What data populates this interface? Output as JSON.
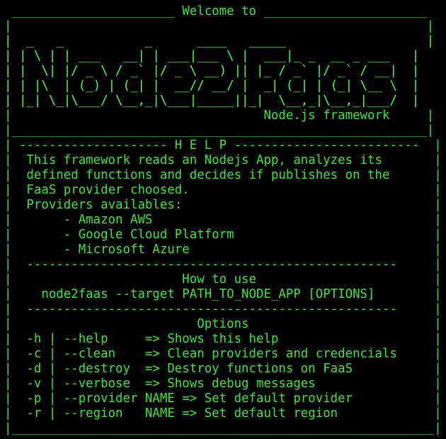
{
  "colors": {
    "background": "#000000",
    "text": "#39e639"
  },
  "terminal": {
    "lines": [
      " ______________________ Welcome to ______________________",
      "|                                                        |",
      "|  _   _           _      ____   _____                   |",
      "| | \\ | | ___   __| | ___|___ \\ |  ___|_ _  __ _ ___   |",
      "| |  \\| |/ _ \\ / _` |/ _ \\ __) || |_ / _` |/ _` / __|  |",
      "| | |\\  | (_) | (_| |  __// __/ |  _| (_| | (_| \\__ \\  |",
      "| |_| \\_|\\___/ \\__,_|\\___|_____||_|  \\__,_|\\__,_|___/  |",
      "|                                  Node.js framework     |",
      "|________________________________________________________|",
      "| -------------------- H E L P -------------------------  |",
      "|  This framework reads an Nodejs App, analyzes its       |",
      "|  defined functions and decides if publishes on the      |",
      "|  FaaS provider choosed.                                 |",
      "|  Providers availables:                                  |",
      "|       - Amazon AWS                                      |",
      "|       - Google Cloud Platform                           |",
      "|       - Microsoft Azure                                 |",
      "|  --------------------------------------------------     |",
      "|                       How to use                        |",
      "|    node2faas --target PATH_TO_NODE_APP [OPTIONS]        |",
      "|  --------------------------------------------------     |",
      "|                         Options                         |",
      "|  -h | --help     => Shows this help                     |",
      "|  -c | --clean    => Clean providers and credencials     |",
      "|  -d | --destroy  => Destroy functions on FaaS           |",
      "|  -v | --verbose  => Shows debug messages                |",
      "|  -p | --provider NAME => Set default provider           |",
      "|  -r | --region   NAME => Set default region             |",
      "|_________________________________________________________|"
    ]
  }
}
